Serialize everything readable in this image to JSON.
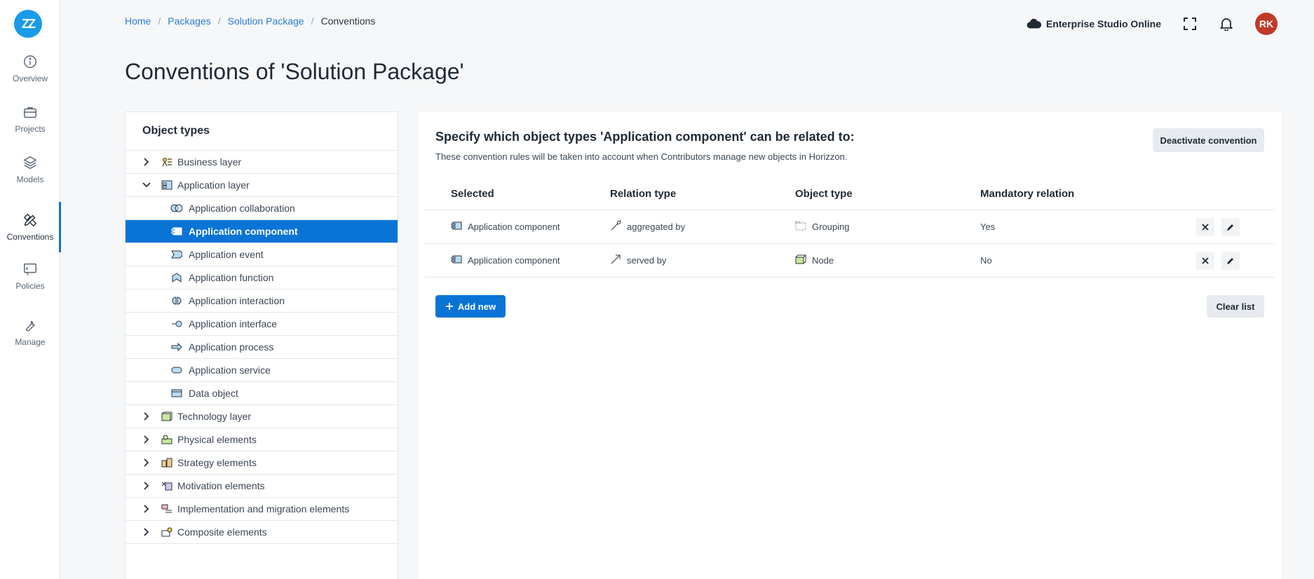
{
  "logo": {
    "text": "ZZ"
  },
  "sidebar": {
    "items": [
      {
        "label": "Overview",
        "icon": "info-icon"
      },
      {
        "label": "Projects",
        "icon": "briefcase-icon"
      },
      {
        "label": "Models",
        "icon": "layers-icon"
      },
      {
        "label": "Conventions",
        "icon": "pencil-ruler-icon",
        "active": true
      },
      {
        "label": "Policies",
        "icon": "policy-icon"
      },
      {
        "label": "Manage",
        "icon": "wrench-icon"
      }
    ]
  },
  "breadcrumb": {
    "items": [
      "Home",
      "Packages",
      "Solution Package"
    ],
    "separator": "/",
    "current": "Conventions"
  },
  "header": {
    "studio_name": "Enterprise Studio Online",
    "avatar_initials": "RK",
    "avatar_color": "#c0392b"
  },
  "page": {
    "title": "Conventions of 'Solution Package'"
  },
  "object_types": {
    "heading": "Object types",
    "layers": [
      {
        "label": "Business layer",
        "expanded": false
      },
      {
        "label": "Application layer",
        "expanded": true
      },
      {
        "label": "Technology layer",
        "expanded": false
      },
      {
        "label": "Physical elements",
        "expanded": false
      },
      {
        "label": "Strategy elements",
        "expanded": false
      },
      {
        "label": "Motivation elements",
        "expanded": false
      },
      {
        "label": "Implementation and migration elements",
        "expanded": false
      },
      {
        "label": "Composite elements",
        "expanded": false
      }
    ],
    "application_children": [
      "Application collaboration",
      "Application component",
      "Application event",
      "Application function",
      "Application interaction",
      "Application interface",
      "Application process",
      "Application service",
      "Data object"
    ],
    "selected": "Application component"
  },
  "convention": {
    "title": "Specify which object types 'Application component' can be related to:",
    "description": "These convention rules will be taken into account when Contributors manage new objects in Horizzon.",
    "deactivate_label": "Deactivate convention",
    "add_label": "Add new",
    "clear_label": "Clear list",
    "columns": [
      "Selected",
      "Relation type",
      "Object type",
      "Mandatory relation"
    ],
    "rows": [
      {
        "selected": "Application component",
        "relation": "aggregated by",
        "object_type": "Grouping",
        "mandatory": "Yes"
      },
      {
        "selected": "Application component",
        "relation": "served by",
        "object_type": "Node",
        "mandatory": "No"
      }
    ]
  },
  "colors": {
    "accent": "#0a74d6",
    "link": "#2a7bd5",
    "logo": "#1a9be8"
  }
}
